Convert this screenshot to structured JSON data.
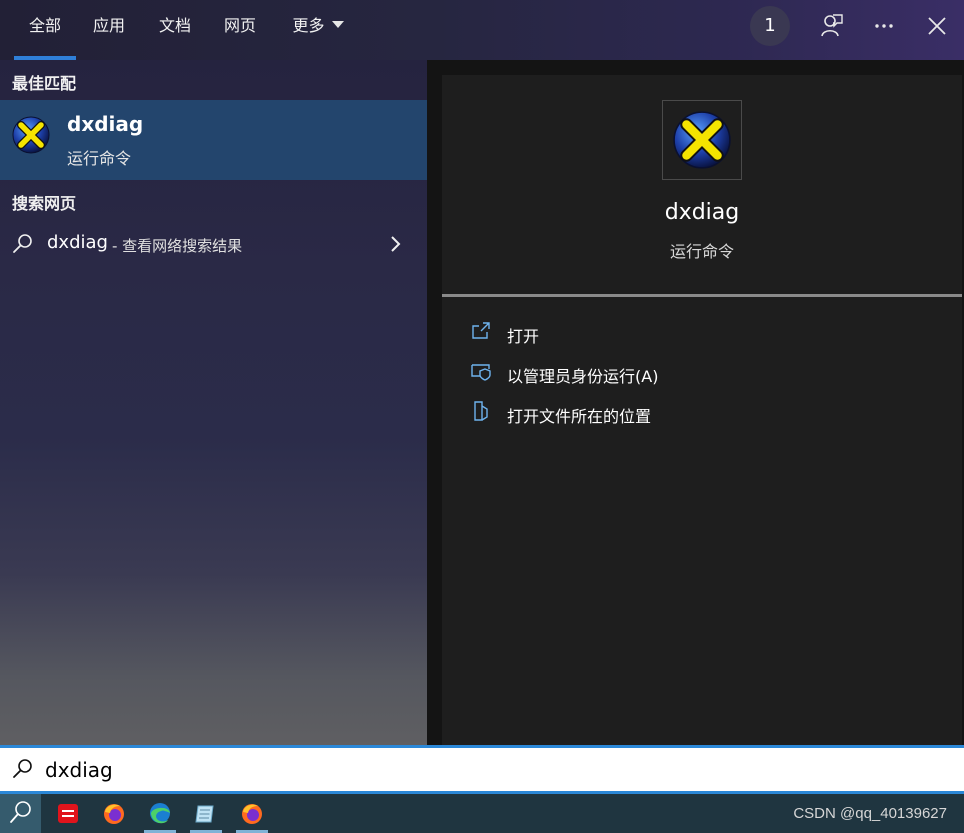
{
  "tabs": [
    {
      "label": "全部",
      "active": true
    },
    {
      "label": "应用",
      "active": false
    },
    {
      "label": "文档",
      "active": false
    },
    {
      "label": "网页",
      "active": false
    },
    {
      "label": "更多",
      "active": false
    }
  ],
  "header": {
    "badge_count": "1",
    "icons": [
      "feedback-icon",
      "more-icon",
      "close-icon"
    ]
  },
  "left": {
    "best_match_title": "最佳匹配",
    "best_match": {
      "name": "dxdiag",
      "kind": "运行命令",
      "icon": "directx-icon"
    },
    "web_section_title": "搜索网页",
    "web_result": {
      "term": "dxdiag",
      "suffix": "- 查看网络搜索结果"
    }
  },
  "detail": {
    "name": "dxdiag",
    "kind": "运行命令",
    "actions": [
      {
        "label": "打开",
        "icon": "open-icon"
      },
      {
        "label": "以管理员身份运行(A)",
        "icon": "run-as-admin-icon"
      },
      {
        "label": "打开文件所在的位置",
        "icon": "file-location-icon"
      }
    ]
  },
  "search": {
    "value": "dxdiag"
  },
  "taskbar": {
    "apps": [
      "youdao-icon",
      "firefox-icon",
      "edge-icon",
      "notepad-icon",
      "firefox-icon"
    ],
    "watermark": "CSDN @qq_40139627"
  },
  "colors": {
    "accent": "#2f7fd8",
    "selection": "#23456d"
  }
}
